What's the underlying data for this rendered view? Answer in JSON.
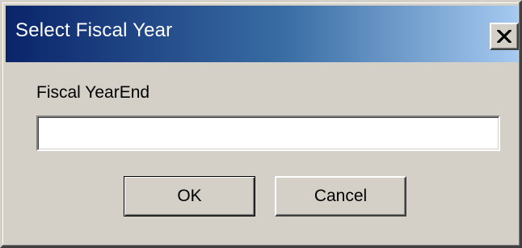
{
  "window": {
    "title": "Select Fiscal Year",
    "close_icon": "close-icon"
  },
  "form": {
    "field_label": "Fiscal YearEnd",
    "field_value": ""
  },
  "buttons": {
    "ok_label": "OK",
    "cancel_label": "Cancel"
  },
  "colors": {
    "titlebar_start": "#0a246a",
    "titlebar_end": "#a6caf0",
    "dialog_face": "#d4d0c8"
  }
}
